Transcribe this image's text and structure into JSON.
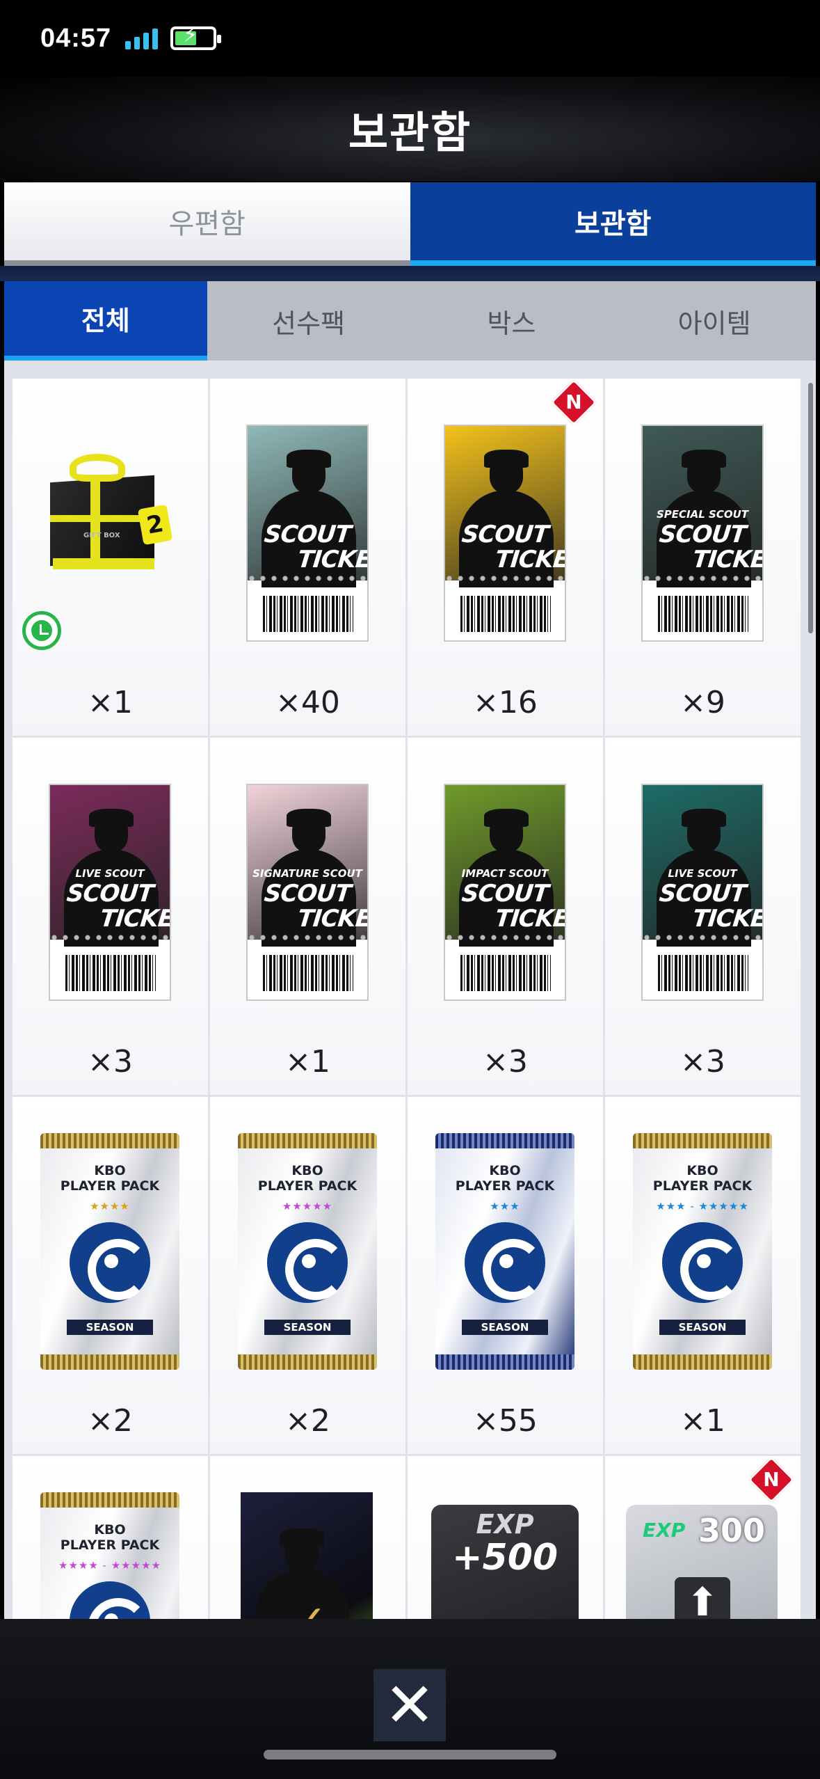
{
  "status_bar": {
    "time": "04:57"
  },
  "header": {
    "title": "보관함"
  },
  "main_tabs": [
    {
      "label": "우편함",
      "active": false
    },
    {
      "label": "보관함",
      "active": true
    }
  ],
  "sub_tabs": [
    {
      "label": "전체",
      "active": true
    },
    {
      "label": "선수팩",
      "active": false
    },
    {
      "label": "박스",
      "active": false
    },
    {
      "label": "아이템",
      "active": false
    }
  ],
  "items": [
    {
      "kind": "gift-box",
      "qty": "×1",
      "box_text": "GIFT BOX",
      "tag": "2",
      "timer": true
    },
    {
      "kind": "scout-ticket",
      "qty": "×40",
      "line1": "SCOUT",
      "line2": "TICKET",
      "sublabel": "",
      "art": "#8fb9b8"
    },
    {
      "kind": "scout-ticket",
      "qty": "×16",
      "line1": "SCOUT",
      "line2": "TICKET",
      "sublabel": "",
      "art": "#f3c21c",
      "badge": "N"
    },
    {
      "kind": "scout-ticket",
      "qty": "×9",
      "line1": "SCOUT",
      "line2": "TICKET",
      "sublabel": "SPECIAL SCOUT",
      "art": "#3f5a56"
    },
    {
      "kind": "scout-ticket",
      "qty": "×3",
      "line1": "SCOUT",
      "line2": "TICKET",
      "sublabel": "LIVE SCOUT",
      "art": "#7b2b5a"
    },
    {
      "kind": "scout-ticket",
      "qty": "×1",
      "line1": "SCOUT",
      "line2": "TICKET",
      "sublabel": "SIGNATURE SCOUT",
      "art": "#f1d3da"
    },
    {
      "kind": "scout-ticket",
      "qty": "×3",
      "line1": "SCOUT",
      "line2": "TICKET",
      "sublabel": "IMPACT SCOUT",
      "art": "#6f9a2a"
    },
    {
      "kind": "scout-ticket",
      "qty": "×3",
      "line1": "SCOUT",
      "line2": "TICKET",
      "sublabel": "LIVE SCOUT",
      "art": "#1e6b66"
    },
    {
      "kind": "player-pack",
      "qty": "×2",
      "title1": "KBO",
      "title2": "PLAYER PACK",
      "stars": "★★★★",
      "star_color": "#d6a21b",
      "label": "SEASON",
      "blue": false
    },
    {
      "kind": "player-pack",
      "qty": "×2",
      "title1": "KBO",
      "title2": "PLAYER PACK",
      "stars": "★★★★★",
      "star_color": "#c04ad1",
      "label": "SEASON",
      "blue": false
    },
    {
      "kind": "player-pack",
      "qty": "×55",
      "title1": "KBO",
      "title2": "PLAYER PACK",
      "stars": "★★★",
      "star_color": "#1c86d8",
      "label": "SEASON",
      "blue": true
    },
    {
      "kind": "player-pack",
      "qty": "×1",
      "title1": "KBO",
      "title2": "PLAYER PACK",
      "stars": "★★★ - ★★★★★",
      "star_color": "#1c86d8",
      "label": "SEASON",
      "blue": false
    },
    {
      "kind": "player-pack",
      "qty": "",
      "title1": "KBO",
      "title2": "PLAYER PACK",
      "stars": "★★★★ - ★★★★★",
      "star_color": "#c04ad1",
      "label": "",
      "blue": false
    },
    {
      "kind": "select-pack",
      "qty": ""
    },
    {
      "kind": "exp-card",
      "qty": "",
      "top": "EXP",
      "value": "+500"
    },
    {
      "kind": "exp-card-2",
      "qty": "",
      "top": "EXP",
      "value": "300",
      "badge": "N"
    }
  ],
  "close_button": {
    "label": "✕"
  },
  "colors": {
    "active_tab": "#0b3f9c",
    "active_underline": "#1fa6f0",
    "badge": "#d5112a"
  }
}
